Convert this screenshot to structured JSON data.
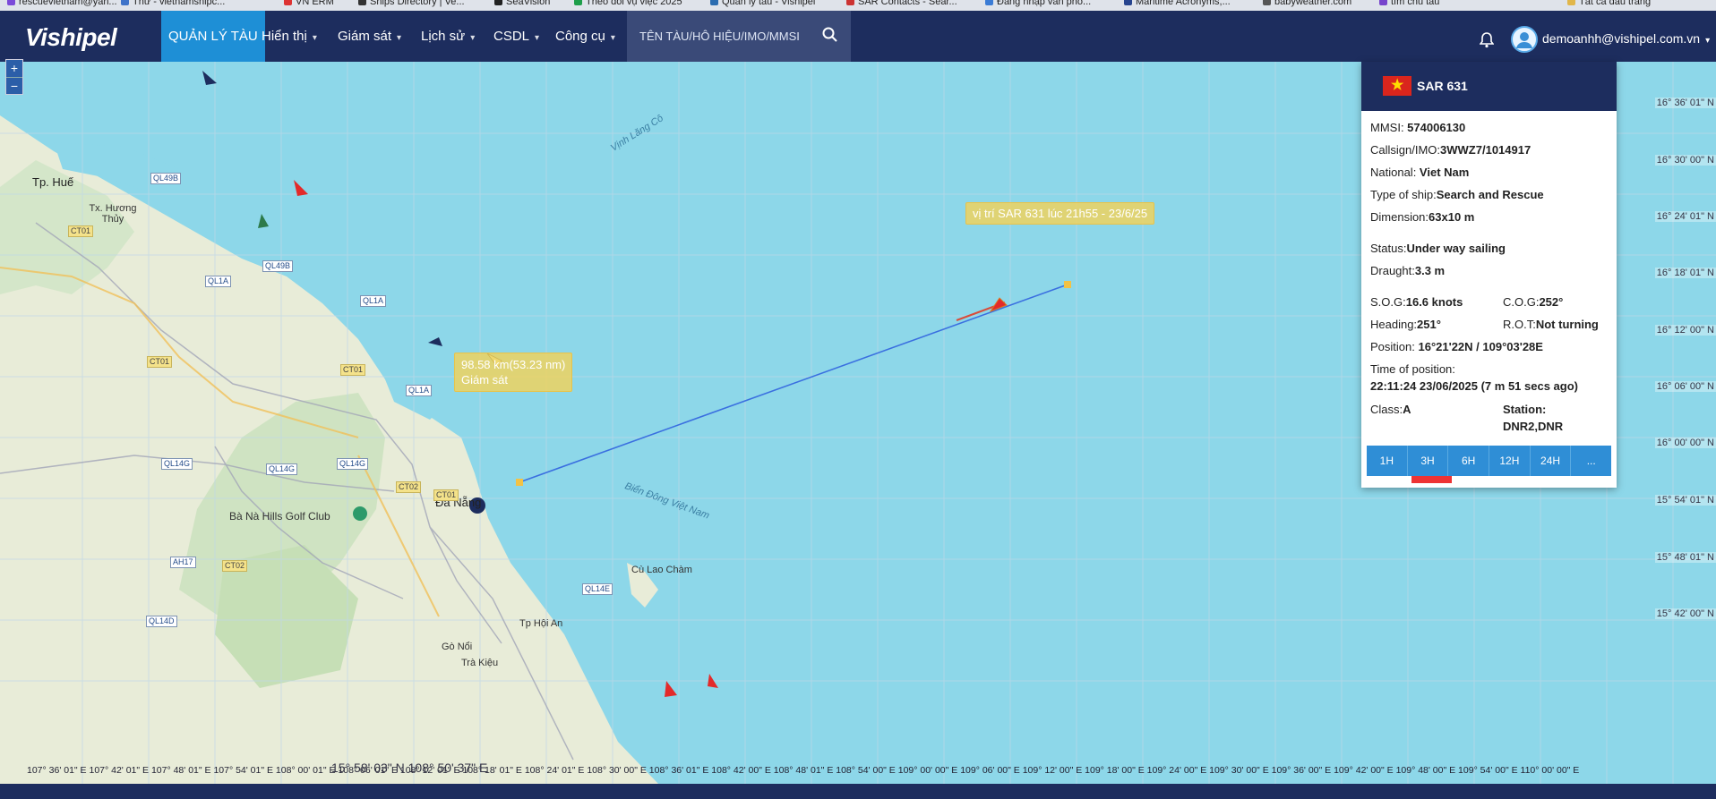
{
  "bookmarks": [
    "rescuevietnam@yah...",
    "Thư - vietnamshipc...",
    "VN ERM",
    "Ships Directory | Ve...",
    "SeaVision",
    "Theo dõi vụ việc 2025",
    "Quản lý tàu - Vishipel",
    "SAR Contacts - Sear...",
    "Đăng nhập vân phò...",
    "Maritime Acronyms,...",
    "babyweather.com",
    "tìm chủ tàu",
    "Tất cả dấu trang"
  ],
  "header": {
    "logo": "Vishipel",
    "nav": [
      {
        "label": "QUẢN LÝ TÀU",
        "active": true,
        "caret": false
      },
      {
        "label": "Hiển thị",
        "caret": true
      },
      {
        "label": "Giám sát",
        "caret": true
      },
      {
        "label": "Lịch sử",
        "caret": true
      },
      {
        "label": "CSDL",
        "caret": true
      },
      {
        "label": "Công cụ",
        "caret": true
      }
    ],
    "search_placeholder": "TÊN TÀU/HÔ HIỆU/IMO/MMSI",
    "user": "demoanhh@vishipel.com.vn"
  },
  "map": {
    "zoom_in": "+",
    "zoom_out": "−",
    "lat_labels": [
      "16° 36' 01\" N",
      "16° 30' 00\" N",
      "16° 24' 01\" N",
      "16° 18' 01\" N",
      "16° 12' 00\" N",
      "16° 06' 00\" N",
      "16° 00' 00\" N",
      "15° 54' 01\" N",
      "15° 48' 01\" N",
      "15° 42' 00\" N"
    ],
    "lon_labels": "107° 36' 01\" E 107° 42' 01\" E 107° 48' 01\" E 107° 54' 01\" E 108° 00' 01\" E 108° 06' 01\" E 108° 12' 01\" E 108° 18' 01\" E 108° 24' 01\" E 108° 30' 00\" E 108° 36' 01\" E 108° 42' 00\" E 108° 48' 01\" E 108° 54' 00\" E 109° 00' 00\" E 109° 06' 00\" E 109° 12' 00\" E 109° 18' 00\" E 109° 24' 00\" E 109° 30' 00\" E 109° 36' 00\" E 109° 42' 00\" E 109° 48' 00\" E 109° 54' 00\" E 110° 00' 00\" E",
    "cursor": "15° 58' 03\" N 108° 50' 37\" E",
    "places": [
      "Tp. Huế",
      "Tx. Hương Thủy",
      "Đà Nẵng",
      "Bà Nà Hills Golf Club",
      "Tp Hội An",
      "Gò Nổi",
      "Trà Kiệu",
      "Cù Lao Chàm",
      "Vịnh Lăng Cô",
      "Biển Đông Việt Nam"
    ],
    "roads": [
      "QL49B",
      "QL49B",
      "CT01",
      "QL1A",
      "QL1A",
      "CT01",
      "CT01",
      "QL1A",
      "QL14G",
      "QL14G",
      "QL14G",
      "CT02",
      "CT01",
      "AH17",
      "CT02",
      "QL14E",
      "QL14D"
    ],
    "track_label": "vị trí SAR 631 lúc 21h55 - 23/6/25",
    "distance_label": "98.58 km(53.23 nm)",
    "distance_sub": "Giám sát"
  },
  "panel": {
    "name": "SAR 631",
    "mmsi_l": "MMSI: ",
    "mmsi": "574006130",
    "callsign_l": "Callsign/IMO:",
    "callsign": "3WWZ7/1014917",
    "national_l": "National: ",
    "national": "Viet Nam",
    "type_l": "Type of ship:",
    "type": "Search and Rescue",
    "dim_l": "Dimension:",
    "dim": "63x10 m",
    "status_l": "Status:",
    "status": "Under way sailing",
    "draught_l": "Draught:",
    "draught": "3.3 m",
    "sog_l": "S.O.G:",
    "sog": "16.6 knots",
    "cog_l": "C.O.G:",
    "cog": "252°",
    "heading_l": "Heading:",
    "heading": "251°",
    "rot_l": "R.O.T:",
    "rot": "Not turning",
    "pos_l": "Position: ",
    "pos": "16°21'22N / 109°03'28E",
    "time_l": "Time of position:",
    "time": "22:11:24 23/06/2025 (7 m 51 secs ago)",
    "class_l": "Class:",
    "class": "A",
    "station_l": "Station:",
    "station": "DNR2,DNR",
    "tabs": [
      "1H",
      "3H",
      "6H",
      "12H",
      "24H",
      "..."
    ]
  }
}
